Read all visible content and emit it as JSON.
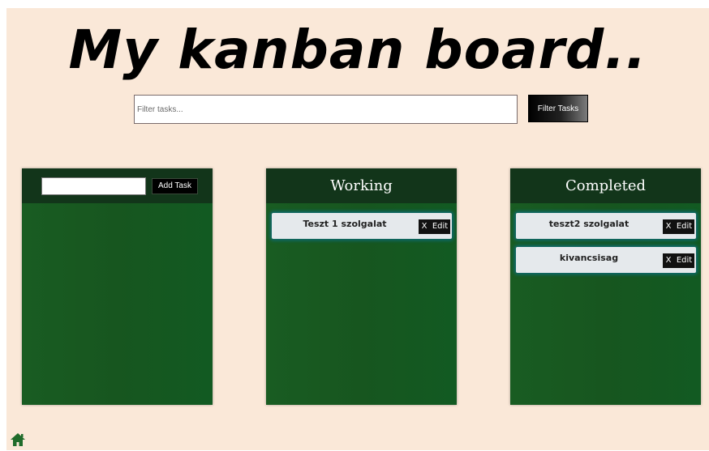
{
  "app": {
    "title": "My kanban board.."
  },
  "filter": {
    "placeholder": "Filter tasks...",
    "value": "",
    "button_label": "Filter Tasks"
  },
  "columns": [
    {
      "title": "",
      "add_input_value": "",
      "add_button_label": "Add Task",
      "tasks": []
    },
    {
      "title": "Working",
      "tasks": [
        {
          "title": "Teszt 1 szolgalat",
          "delete_label": "X",
          "edit_label": "Edit"
        }
      ]
    },
    {
      "title": "Completed",
      "tasks": [
        {
          "title": "teszt2 szolgalat",
          "delete_label": "X",
          "edit_label": "Edit"
        },
        {
          "title": "kivancsisag",
          "delete_label": "X",
          "edit_label": "Edit"
        }
      ]
    }
  ],
  "footer": {
    "home_icon": "home-icon",
    "icon_color": "#1f6b2a"
  },
  "colors": {
    "page_background": "#fae8d8",
    "column_background": "#17561f",
    "column_header": "#12351a",
    "task_background": "#e5e9ec",
    "task_glow": "#0d6b75"
  }
}
